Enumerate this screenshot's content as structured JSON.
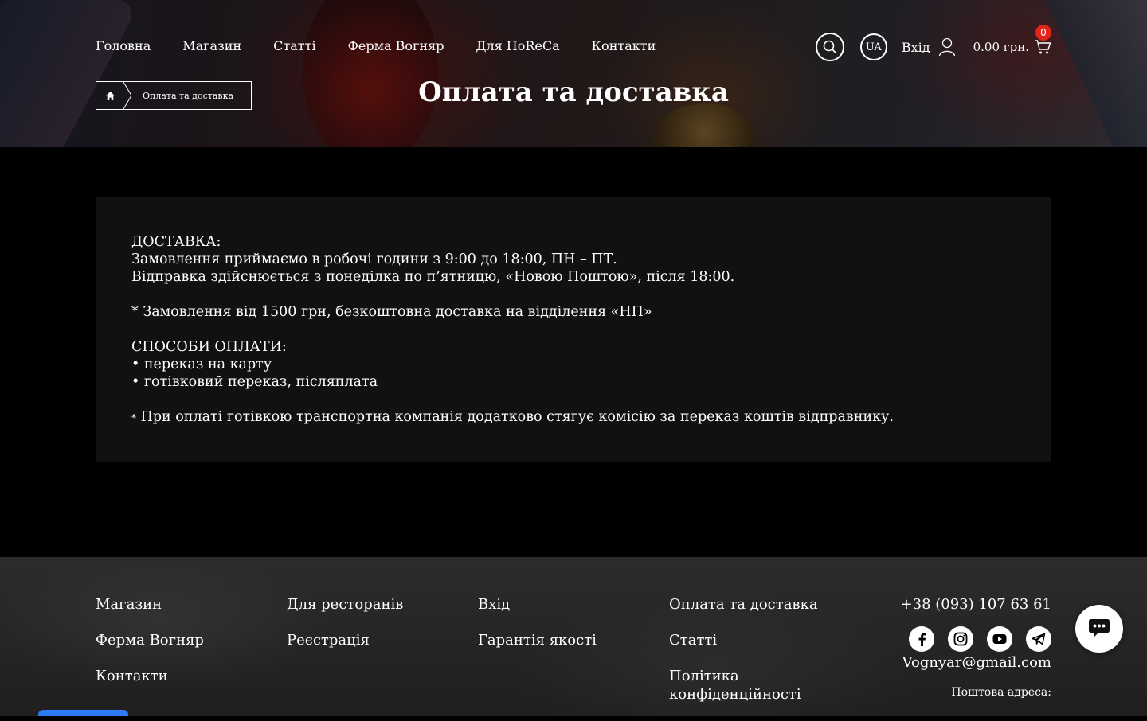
{
  "nav": {
    "items": [
      {
        "label": "Головна"
      },
      {
        "label": "Магазин"
      },
      {
        "label": "Статті"
      },
      {
        "label": "Ферма Вогняр"
      },
      {
        "label": "Для HoReCa"
      },
      {
        "label": "Контакти"
      }
    ]
  },
  "header": {
    "search_icon": "search-icon",
    "lang": "UA",
    "login_label": "Вхід",
    "user_icon": "user-icon",
    "cart_sum": "0.00 грн.",
    "cart_count": "0",
    "cart_icon": "cart-icon"
  },
  "breadcrumb": {
    "home_icon": "home-icon",
    "current": "Оплата та доставка"
  },
  "page": {
    "title": "Оплата та доставка"
  },
  "content": {
    "delivery_heading": "ДОСТАВКА:",
    "delivery_line1": "Замовлення приймаємо в робочі години з 9:00 до 18:00, ПН – ПТ.",
    "delivery_line2": "Відправка здійснюється з понеділка по п’ятницю, «Новою Поштою», після 18:00.",
    "free_delivery": "* Замовлення від 1500 грн, безкоштовна доставка на відділення «НП»",
    "payment_heading": "СПОСОБИ ОПЛАТИ:",
    "payment_item1": "• переказ на карту",
    "payment_item2": "• готівковий переказ,  післяплата",
    "note_star": "*",
    "note": " При оплаті готівкою транспортна компанія додатково стягує комісію за переказ коштів відправнику."
  },
  "footer": {
    "col1": [
      {
        "label": "Магазин"
      },
      {
        "label": "Ферма Вогняр"
      },
      {
        "label": "Контакти"
      }
    ],
    "col2": [
      {
        "label": "Для ресторанів"
      },
      {
        "label": "Реєстрація"
      }
    ],
    "col3": [
      {
        "label": "Вхід"
      },
      {
        "label": "Гарантія якості"
      }
    ],
    "col4": [
      {
        "label": "Оплата та доставка"
      },
      {
        "label": "Статті"
      },
      {
        "label": "Політика конфіденційності"
      }
    ],
    "phone": "+38 (093) 107 63 61",
    "socials": [
      "facebook-icon",
      "instagram-icon",
      "youtube-icon",
      "telegram-icon"
    ],
    "email": "Vognyar@gmail.com",
    "postal_label": "Поштова адреса:"
  },
  "colors": {
    "accent_red": "#e1251b",
    "chat_blue": "#2f7bf6"
  }
}
